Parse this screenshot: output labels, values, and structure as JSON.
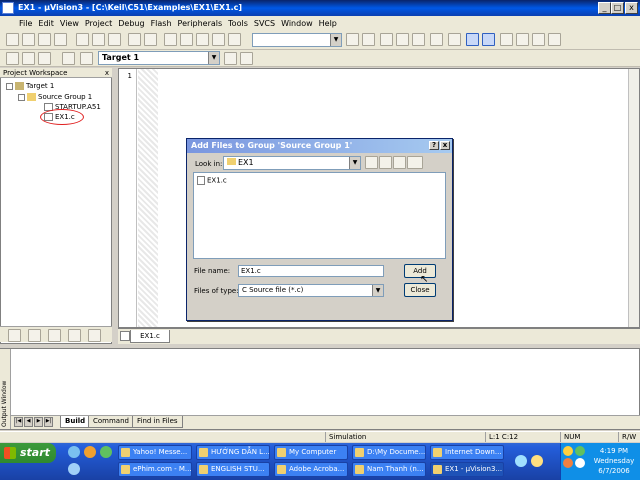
{
  "window": {
    "title": "EX1  - µVision3 - [C:\\Keil\\C51\\Examples\\EX1\\EX1.c]",
    "controls": [
      "_",
      "□",
      "x"
    ]
  },
  "menubar": [
    "File",
    "Edit",
    "View",
    "Project",
    "Debug",
    "Flash",
    "Peripherals",
    "Tools",
    "SVCS",
    "Window",
    "Help"
  ],
  "toolbar2": {
    "target": "Target 1"
  },
  "workspace": {
    "title": "Project Workspace",
    "close": "x",
    "tree": {
      "root": "Target 1",
      "group": "Source Group 1",
      "files": [
        "STARTUP.A51",
        "EX1.c"
      ]
    }
  },
  "editor": {
    "line_numbers": [
      "1"
    ],
    "tab": "EX1.c"
  },
  "dialog": {
    "title": "Add Files to Group 'Source Group 1'",
    "help": "?",
    "close": "x",
    "look_in_label": "Look in:",
    "look_in_value": "EX1",
    "files": [
      "EX1.c"
    ],
    "file_name_label": "File name:",
    "file_name_value": "EX1.c",
    "file_type_label": "Files of type:",
    "file_type_value": "C Source file (*.c)",
    "add_button": "Add",
    "close_button": "Close"
  },
  "output": {
    "side_label": "Output Window",
    "tabs": [
      "Build",
      "Command",
      "Find in Files"
    ]
  },
  "statusbar": {
    "mode": "Simulation",
    "position": "L:1 C:12",
    "num": "NUM",
    "rw": "R/W"
  },
  "taskbar": {
    "start": "start",
    "tasks_row1": [
      "Yahoo! Messe...",
      "HƯỚNG DẪN L...",
      "My Computer",
      "D:\\My Docume...",
      "Internet Down..."
    ],
    "tasks_row2": [
      "ePhim.com - M...",
      "ENGLISH STU...",
      "Adobe Acroba...",
      "Nam Thanh (n...",
      "EX1 - µVision3..."
    ],
    "clock": {
      "time": "4:19 PM",
      "day": "Wednesday",
      "date": "6/7/2006"
    }
  }
}
